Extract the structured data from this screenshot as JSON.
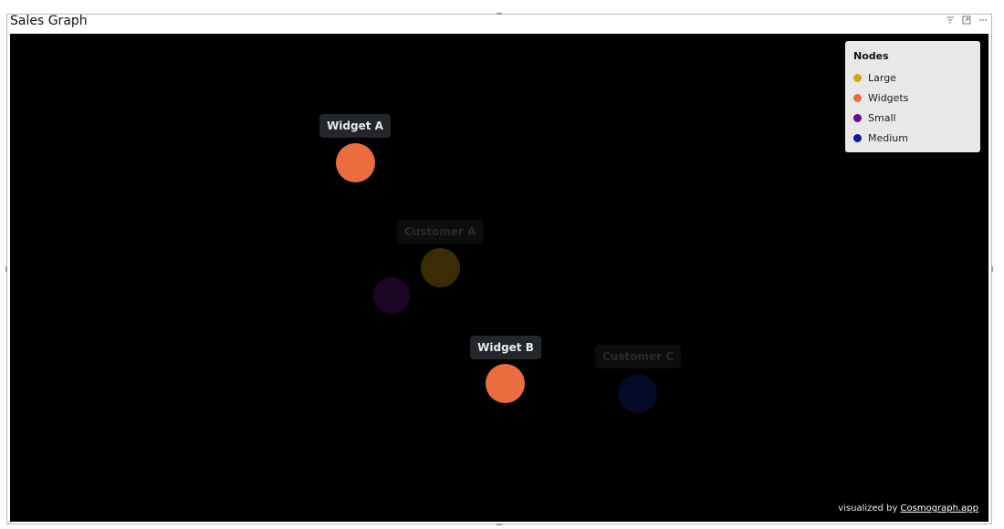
{
  "visual": {
    "title": "Sales Graph",
    "header_icons": [
      "filter-icon",
      "focus-mode-icon",
      "more-options-icon"
    ]
  },
  "legend": {
    "title": "Nodes",
    "items": [
      {
        "label": "Large",
        "color": "#d4a615"
      },
      {
        "label": "Widgets",
        "color": "#ea6d3f"
      },
      {
        "label": "Small",
        "color": "#6a0a8b"
      },
      {
        "label": "Medium",
        "color": "#0c1a99"
      }
    ]
  },
  "nodes": [
    {
      "label": "Widget A",
      "color": "#ea6d3f",
      "highlighted": true
    },
    {
      "label": "Customer A",
      "color": "#3a2c04",
      "highlighted": false
    },
    {
      "label": "",
      "color": "#1c0624",
      "highlighted": false
    },
    {
      "label": "Widget B",
      "color": "#ea6d3f",
      "highlighted": true
    },
    {
      "label": "Customer C",
      "color": "#050a26",
      "highlighted": false
    }
  ],
  "footer": {
    "prefix": "visualized by",
    "link": "Cosmograph.app"
  }
}
